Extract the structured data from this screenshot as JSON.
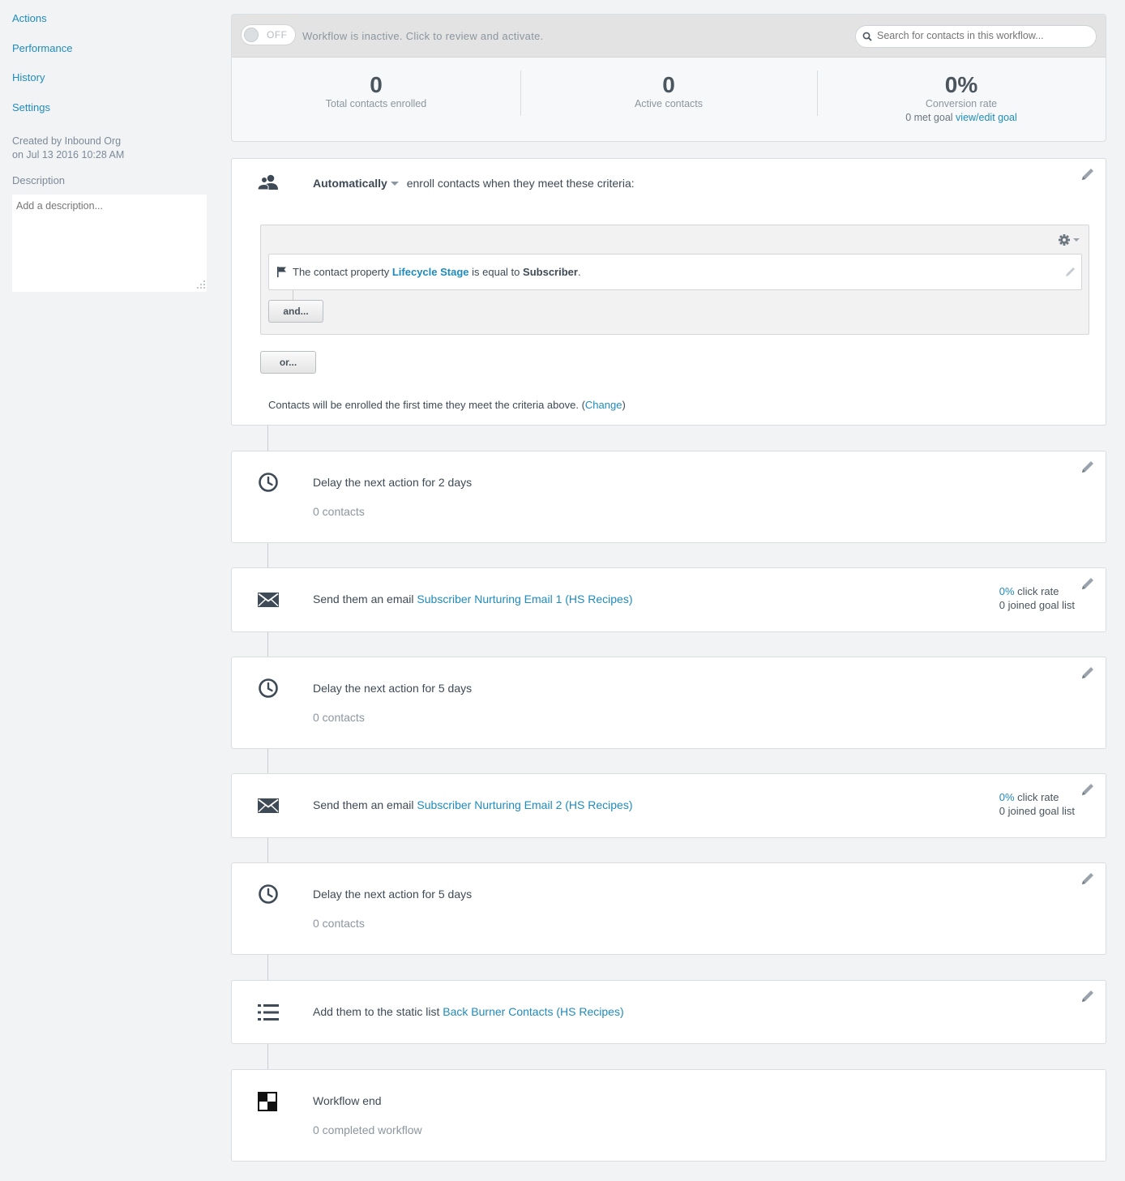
{
  "sidebar": {
    "nav": [
      {
        "label": "Actions"
      },
      {
        "label": "Performance"
      },
      {
        "label": "History"
      },
      {
        "label": "Settings"
      }
    ],
    "created_by": "Created by Inbound Org",
    "created_on": "on Jul 13 2016 10:28 AM",
    "description_label": "Description",
    "description_placeholder": "Add a description..."
  },
  "status": {
    "toggle_label": "OFF",
    "message": "Workflow is inactive. Click to review and activate.",
    "search_placeholder": "Search for contacts in this workflow..."
  },
  "stats": {
    "total_enrolled": {
      "value": "0",
      "label": "Total contacts enrolled"
    },
    "active": {
      "value": "0",
      "label": "Active contacts"
    },
    "conversion": {
      "value": "0%",
      "label": "Conversion rate",
      "goal_text": "0 met goal",
      "goal_link": "view/edit goal"
    }
  },
  "enrollment": {
    "mode": "Automatically",
    "text": "enroll contacts when they meet these criteria:",
    "criteria": {
      "prefix": "The contact property",
      "property": "Lifecycle Stage",
      "operator": "is equal to",
      "value": "Subscriber",
      "suffix": "."
    },
    "and_button": "and...",
    "or_button": "or...",
    "note_text": "Contacts will be enrolled the first time they meet the criteria above. (",
    "note_link": "Change",
    "note_end": ")"
  },
  "steps": [
    {
      "type": "delay",
      "icon": "clock-icon",
      "title": "Delay the next action for 2 days",
      "sub": "0 contacts"
    },
    {
      "type": "email",
      "icon": "envelope-icon",
      "prefix": "Send them an email ",
      "link": "Subscriber Nurturing Email 1 (HS Recipes)",
      "click_pct": "0%",
      "click_label": " click rate",
      "goal": "0 joined goal list"
    },
    {
      "type": "delay",
      "icon": "clock-icon",
      "title": "Delay the next action for 5 days",
      "sub": "0 contacts"
    },
    {
      "type": "email",
      "icon": "envelope-icon",
      "prefix": "Send them an email ",
      "link": "Subscriber Nurturing Email 2 (HS Recipes)",
      "click_pct": "0%",
      "click_label": " click rate",
      "goal": "0 joined goal list"
    },
    {
      "type": "delay",
      "icon": "clock-icon",
      "title": "Delay the next action for 5 days",
      "sub": "0 contacts"
    },
    {
      "type": "list",
      "icon": "list-icon",
      "prefix": "Add them to the static list ",
      "link": "Back Burner Contacts (HS Recipes)"
    },
    {
      "type": "end",
      "icon": "checkered-flag-icon",
      "title": "Workflow end",
      "sub": "0 completed workflow"
    }
  ]
}
